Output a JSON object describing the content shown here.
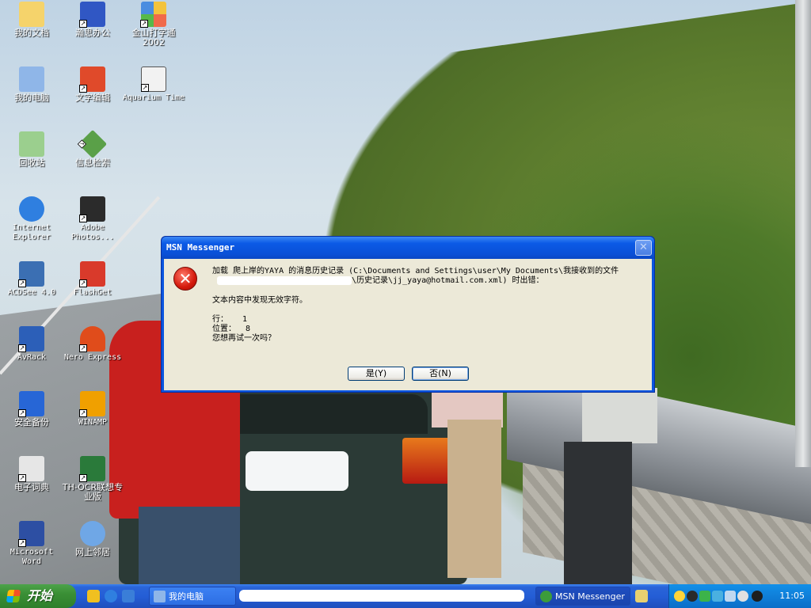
{
  "desktop_icons": [
    {
      "id": "my-documents",
      "label": "我的文档",
      "color": "#f5d36b"
    },
    {
      "id": "my-computer",
      "label": "我的电脑",
      "color": "#8fb6e8"
    },
    {
      "id": "recycle-bin",
      "label": "回收站",
      "color": "#9bcf8e"
    },
    {
      "id": "internet-explorer",
      "label": "Internet Explorer",
      "color": "#2f7fe0"
    },
    {
      "id": "acdsee",
      "label": "ACDSee 4.0",
      "color": "#3b6fb3"
    },
    {
      "id": "avrack",
      "label": "AvRack",
      "color": "#2c5fb8"
    },
    {
      "id": "safe-backup",
      "label": "安全备份",
      "color": "#2766d6"
    },
    {
      "id": "electronic-dictionary",
      "label": "电子词典",
      "color": "#e6e6e6"
    },
    {
      "id": "microsoft-word",
      "label": "Microsoft Word",
      "color": "#2d4fa3"
    },
    {
      "id": "hanwang-office",
      "label": "瀚思办公",
      "color": "#3057c4"
    },
    {
      "id": "text-editor",
      "label": "文字编辑",
      "color": "#e04a2a"
    },
    {
      "id": "info-search",
      "label": "信息检索",
      "color": "#5aa048"
    },
    {
      "id": "adobe-photoshop",
      "label": "Adobe Photos...",
      "color": "#2b2b2b"
    },
    {
      "id": "flashget",
      "label": "FlashGet",
      "color": "#d93a2b"
    },
    {
      "id": "nero-express",
      "label": "Nero Express",
      "color": "#e04c1b"
    },
    {
      "id": "winamp",
      "label": "WINAMP",
      "color": "#f0a000"
    },
    {
      "id": "th-ocr",
      "label": "TH-OCR联想专业版",
      "color": "#2a7a3a"
    },
    {
      "id": "network-neighborhood",
      "label": "网上邻居",
      "color": "#6fa7e6"
    },
    {
      "id": "jinshan-typing",
      "label": "金山打字通2002",
      "color": "#d0d0d0"
    },
    {
      "id": "aquarium-time",
      "label": "Aquarium Time",
      "color": "#f2f2f2"
    }
  ],
  "dialog": {
    "title": "MSN Messenger",
    "close_glyph": "✕",
    "error_glyph": "✕",
    "line1": "加载 爬上岸的YAYA 的消息历史记录 (C:\\Documents and Settings\\user\\My Documents\\我接收到的文件",
    "line2": "\\历史记录\\jj_yaya@hotmail.com.xml) 时出错：",
    "line3": "文本内容中发现无效字符。",
    "line4": "行：   1",
    "line5": "位置：  8",
    "line6": "您想再试一次吗？",
    "yes_label": "是(Y)",
    "no_label": "否(N)"
  },
  "taskbar": {
    "start_label": "开始",
    "tasks": [
      {
        "label": "我的电脑",
        "active": false
      },
      {
        "label": "MSN Messenger",
        "active": true
      }
    ],
    "clock": "11:05"
  }
}
